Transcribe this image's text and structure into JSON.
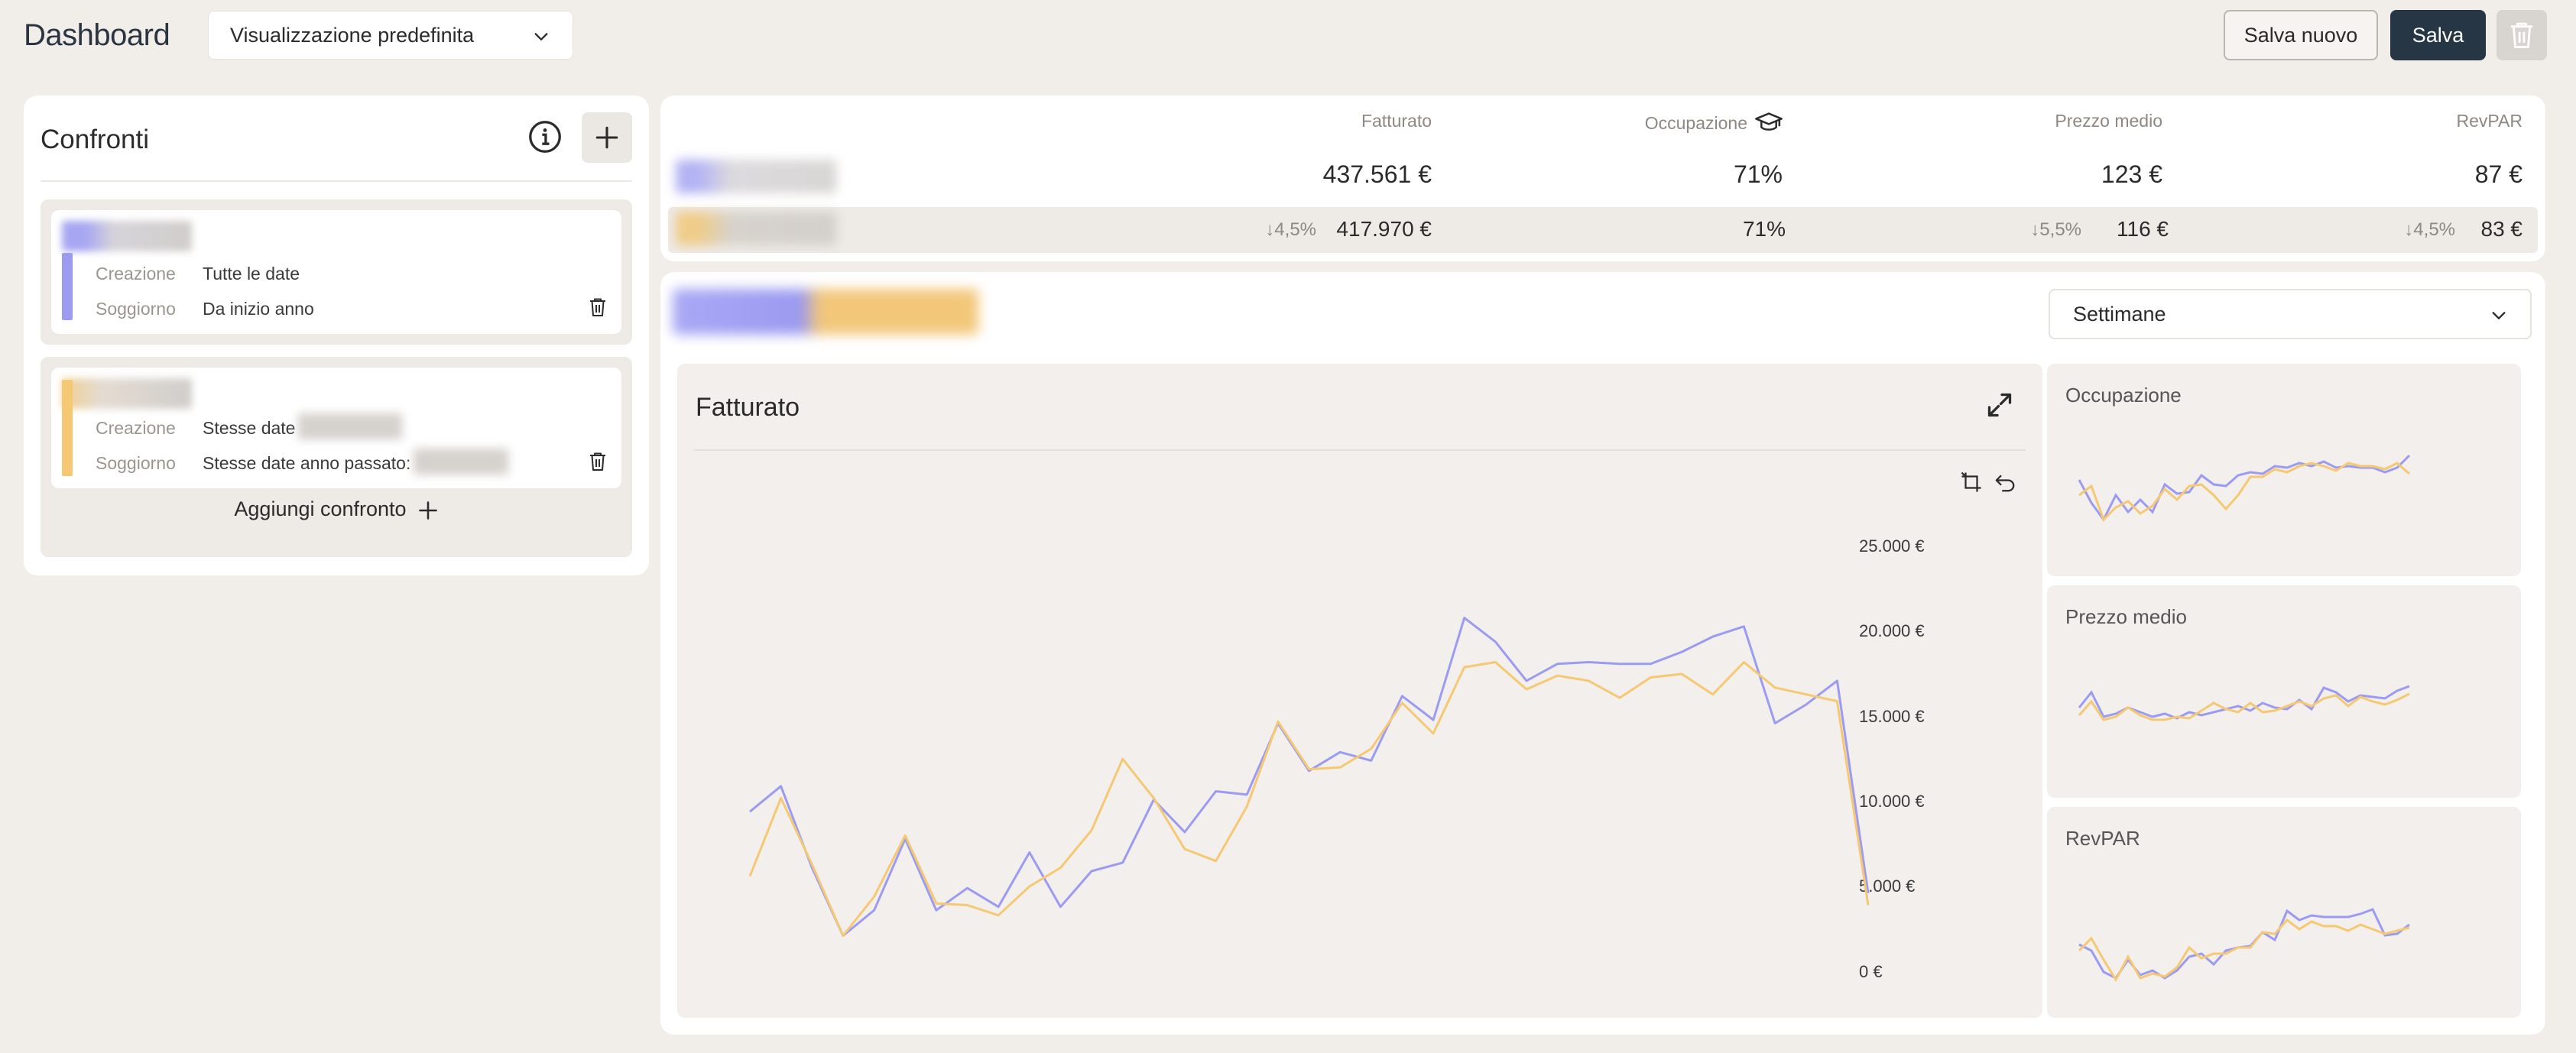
{
  "header": {
    "title": "Dashboard",
    "view_select_value": "Visualizzazione predefinita",
    "save_new_label": "Salva nuovo",
    "save_label": "Salva"
  },
  "comparisons": {
    "title": "Confronti",
    "items": [
      {
        "color": "#9c9bf2",
        "creation_key": "Creazione",
        "creation_value": "Tutte le date",
        "stay_key": "Soggiorno",
        "stay_value": "Da inizio anno"
      },
      {
        "color": "#f5c874",
        "creation_key": "Creazione",
        "creation_value": "Stesse date",
        "stay_key": "Soggiorno",
        "stay_value": "Stesse date anno passato:"
      }
    ],
    "add_label": "Aggiungi confronto"
  },
  "kpi": {
    "headers": [
      "Fatturato",
      "Occupazione",
      "Prezzo medio",
      "RevPAR"
    ],
    "row1": [
      "437.561 €",
      "71%",
      "123 €",
      "87 €"
    ],
    "row2": [
      "417.970 €",
      "71%",
      "116 €",
      "83 €"
    ],
    "row2_deltas": [
      "↓4,5%",
      "",
      "↓5,5%",
      "↓4,5%"
    ]
  },
  "period_select_value": "Settimane",
  "main_chart": {
    "title": "Fatturato",
    "yticks": [
      "25.000 €",
      "20.000 €",
      "15.000 €",
      "10.000 €",
      "5.000 €",
      "0 €"
    ]
  },
  "small_charts": [
    "Occupazione",
    "Prezzo medio",
    "RevPAR"
  ],
  "colors": {
    "series_current": "#9c9bf2",
    "series_previous": "#f5c874",
    "primary_button": "#263645"
  },
  "chart_data": {
    "type": "line",
    "title": "Fatturato",
    "ylim": [
      0,
      25000
    ],
    "series": [
      {
        "values": [
          9300,
          10800,
          6000,
          2000,
          3500,
          7700,
          3500,
          4800,
          3700,
          6900,
          3700,
          5800,
          6300,
          10000,
          8100,
          10500,
          10300,
          14500,
          11700,
          12800,
          12300,
          16100,
          14700,
          20700,
          19300,
          17000,
          18000,
          18100,
          18000,
          18000,
          18700,
          19600,
          20200,
          14500,
          15600,
          17000,
          4500
        ]
      },
      {
        "values": [
          5500,
          10100,
          6200,
          2000,
          4300,
          7900,
          3900,
          3800,
          3200,
          4900,
          6000,
          8200,
          12400,
          10100,
          7100,
          6400,
          9600,
          14600,
          11800,
          11900,
          13000,
          15700,
          13900,
          17800,
          18100,
          16500,
          17300,
          17000,
          16000,
          17200,
          17400,
          16200,
          18100,
          16600,
          16200,
          15800,
          3800
        ]
      }
    ]
  }
}
